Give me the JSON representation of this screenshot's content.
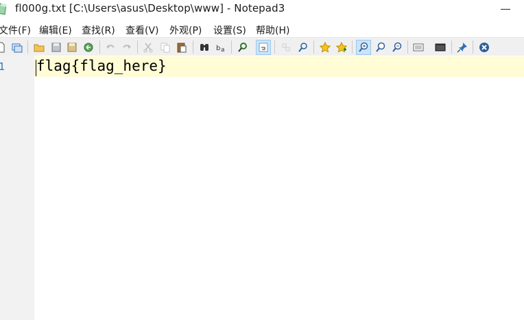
{
  "window": {
    "title": "fl000g.txt [C:\\Users\\asus\\Desktop\\www] - Notepad3"
  },
  "menu": {
    "items": [
      "文件(F)",
      "编辑(E)",
      "查找(R)",
      "查看(V)",
      "外观(P)",
      "设置(S)",
      "帮助(H)"
    ]
  },
  "toolbar": {
    "icons": [
      "new-file-icon",
      "copy-window-icon",
      "open-folder-icon",
      "save-icon",
      "save-as-icon",
      "revert-icon",
      "undo-icon",
      "redo-icon",
      "cut-icon",
      "copy-icon",
      "paste-icon",
      "find-icon",
      "replace-icon",
      "goto-icon",
      "word-wrap-icon",
      "expand-icon",
      "zoom-find-icon",
      "favorite-icon",
      "add-favorite-icon",
      "zoom-in-icon",
      "zoom-reset-icon",
      "zoom-out-icon",
      "view-icon",
      "screen-icon",
      "pin-icon",
      "exit-icon"
    ]
  },
  "editor": {
    "line_number": "1",
    "line_text": "flag{flag_here}"
  },
  "colors": {
    "current_line": "#fffcd6",
    "gutter": "#f2f2f2",
    "toolbar": "#f0f0f0",
    "line_number": "#2b7bb9"
  }
}
